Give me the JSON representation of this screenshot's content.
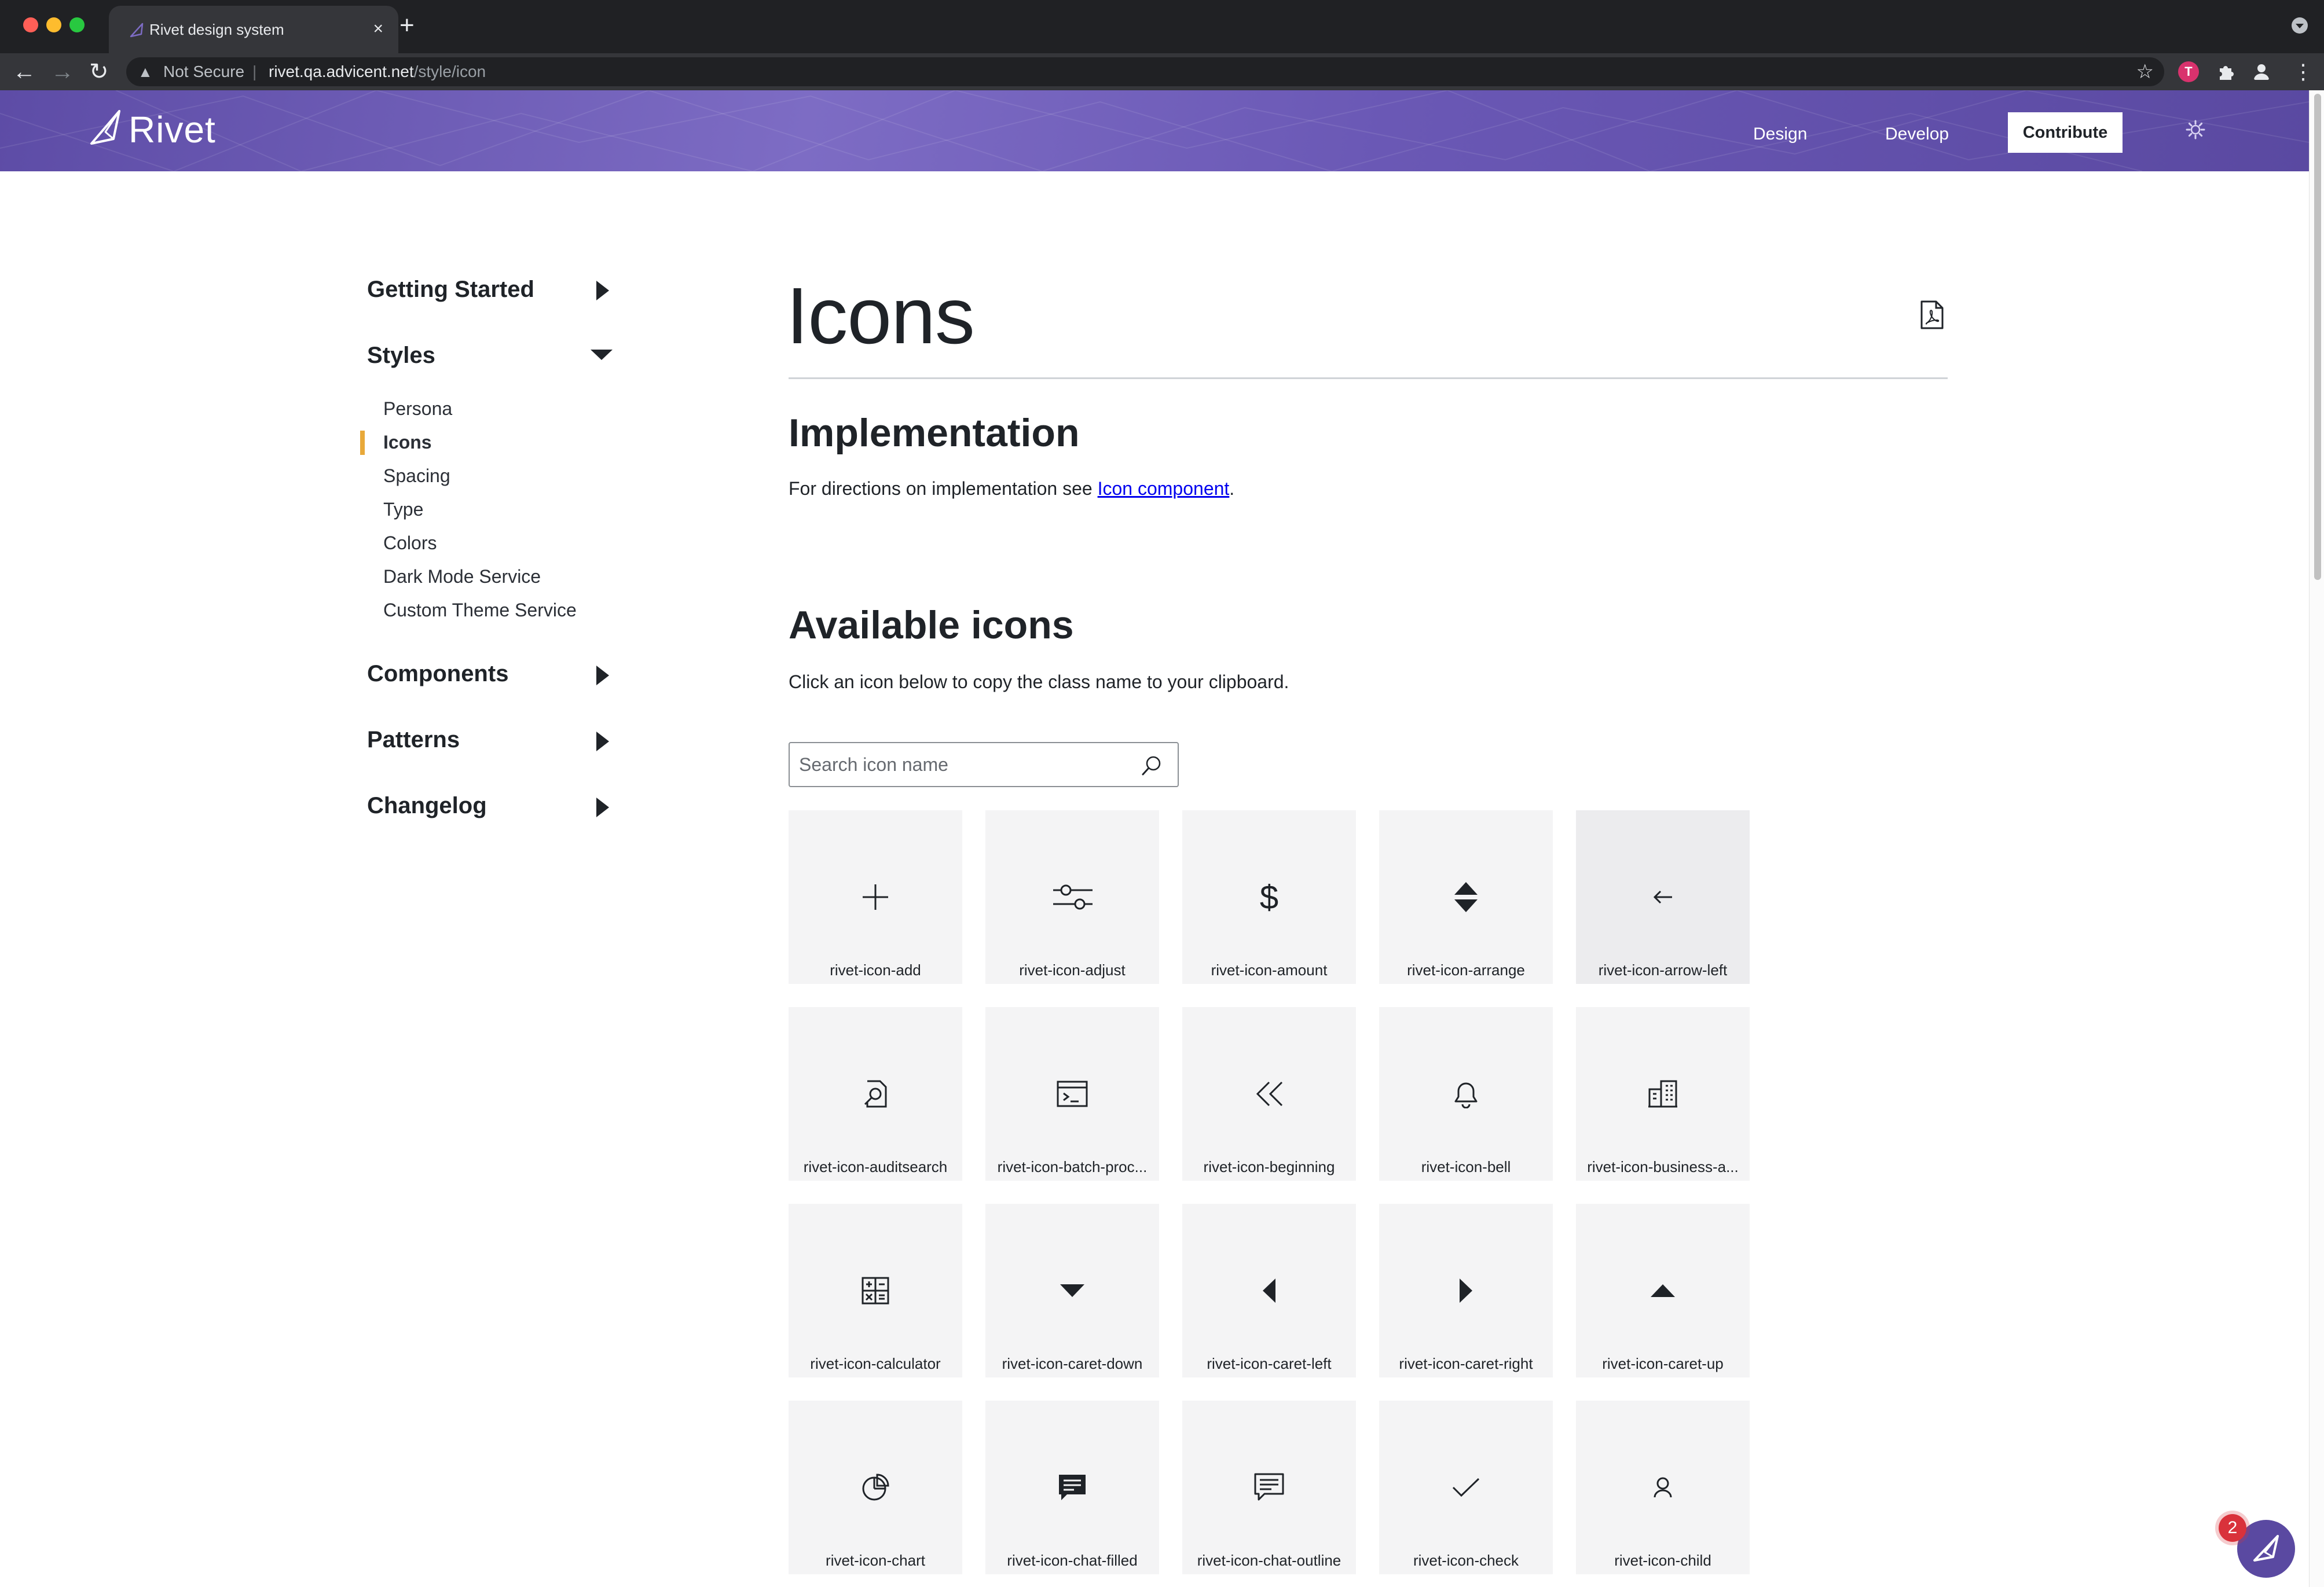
{
  "browser": {
    "tab_title": "Rivet design system",
    "tab_close": "×",
    "new_tab": "+",
    "security_label": "Not Secure",
    "separator": "|",
    "url_host": "rivet.qa.advicent.net",
    "url_path": "/style/icon",
    "nav": {
      "back": "←",
      "forward": "→",
      "reload": "↻"
    },
    "extension_badge": "T",
    "menu_dots": "⋮"
  },
  "header": {
    "logo_text": "Rivet",
    "links": [
      "Design",
      "Develop"
    ],
    "contribute_label": "Contribute",
    "brand_color": "#6a58b5"
  },
  "sidebar": {
    "sections": [
      {
        "label": "Getting Started",
        "expanded": false
      },
      {
        "label": "Styles",
        "expanded": true
      },
      {
        "label": "Components",
        "expanded": false
      },
      {
        "label": "Patterns",
        "expanded": false
      },
      {
        "label": "Changelog",
        "expanded": false
      }
    ],
    "styles_items": [
      "Persona",
      "Icons",
      "Spacing",
      "Type",
      "Colors",
      "Dark Mode Service",
      "Custom Theme Service"
    ],
    "active_item": "Icons",
    "active_color": "#e8a93a"
  },
  "main": {
    "title": "Icons",
    "implementation_heading": "Implementation",
    "implementation_text": "For directions on implementation see ",
    "implementation_link": "Icon component",
    "implementation_end": ".",
    "available_heading": "Available icons",
    "available_text": "Click an icon below to copy the class name to your clipboard.",
    "search_placeholder": "Search icon name",
    "icons": [
      {
        "label": "rivet-icon-add",
        "icon": "plus-icon"
      },
      {
        "label": "rivet-icon-adjust",
        "icon": "sliders-icon"
      },
      {
        "label": "rivet-icon-amount",
        "icon": "dollar-icon"
      },
      {
        "label": "rivet-icon-arrange",
        "icon": "sort-arrows-icon"
      },
      {
        "label": "rivet-icon-arrow-left",
        "icon": "arrow-left-icon"
      },
      {
        "label": "rivet-icon-auditsearch",
        "icon": "document-search-icon"
      },
      {
        "label": "rivet-icon-batch-proc...",
        "icon": "terminal-window-icon"
      },
      {
        "label": "rivet-icon-beginning",
        "icon": "double-chevron-left-icon"
      },
      {
        "label": "rivet-icon-bell",
        "icon": "bell-icon"
      },
      {
        "label": "rivet-icon-business-a...",
        "icon": "building-icon"
      },
      {
        "label": "rivet-icon-calculator",
        "icon": "calculator-icon"
      },
      {
        "label": "rivet-icon-caret-down",
        "icon": "caret-down-icon"
      },
      {
        "label": "rivet-icon-caret-left",
        "icon": "caret-left-icon"
      },
      {
        "label": "rivet-icon-caret-right",
        "icon": "caret-right-icon"
      },
      {
        "label": "rivet-icon-caret-up",
        "icon": "caret-up-icon"
      },
      {
        "label": "rivet-icon-chart",
        "icon": "pie-chart-icon"
      },
      {
        "label": "rivet-icon-chat-filled",
        "icon": "chat-filled-icon"
      },
      {
        "label": "rivet-icon-chat-outline",
        "icon": "chat-outline-icon"
      },
      {
        "label": "rivet-icon-check",
        "icon": "check-icon"
      },
      {
        "label": "rivet-icon-child",
        "icon": "person-icon"
      }
    ]
  },
  "chat_widget": {
    "badge_count": "2"
  }
}
